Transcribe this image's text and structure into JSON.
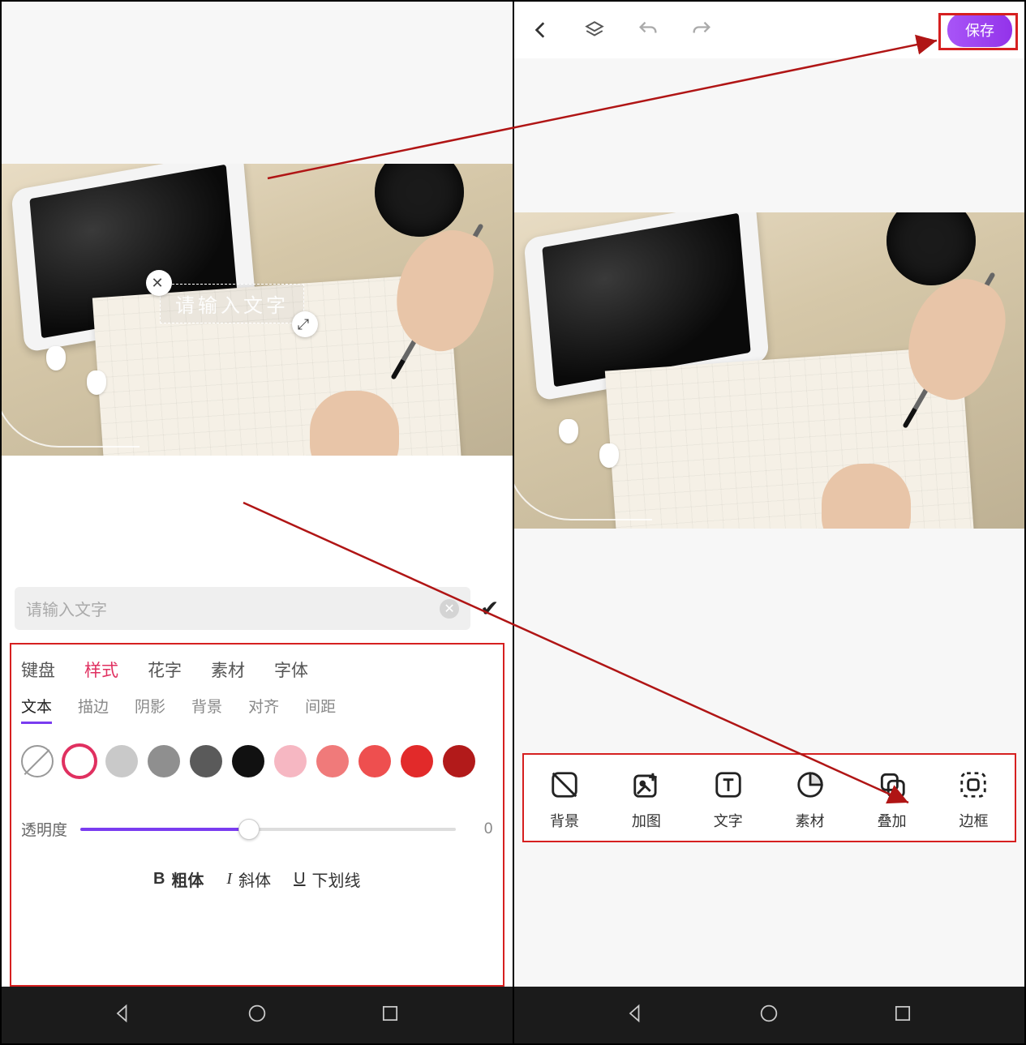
{
  "left": {
    "text_overlay_placeholder": "请输入文字",
    "input_placeholder": "请输入文字",
    "tabs": [
      "键盘",
      "样式",
      "花字",
      "素材",
      "字体"
    ],
    "active_tab": "样式",
    "subtabs": [
      "文本",
      "描边",
      "阴影",
      "背景",
      "对齐",
      "间距"
    ],
    "active_subtab": "文本",
    "swatches": [
      "none",
      "#ffffff",
      "#c9c9c9",
      "#8f8f8f",
      "#5a5a5a",
      "#111111",
      "#f6b7c2",
      "#f07a7a",
      "#ee4f4f",
      "#e22a2a",
      "#b21a1a"
    ],
    "selected_swatch_index": 1,
    "opacity_label": "透明度",
    "opacity_value": "0",
    "format": {
      "bold_symbol": "B",
      "bold_label": "粗体",
      "italic_symbol": "I",
      "italic_label": "斜体",
      "underline_symbol": "U",
      "underline_label": "下划线"
    }
  },
  "right": {
    "save_label": "保存",
    "tools": [
      {
        "key": "bg",
        "label": "背景"
      },
      {
        "key": "addimg",
        "label": "加图"
      },
      {
        "key": "text",
        "label": "文字"
      },
      {
        "key": "sticker",
        "label": "素材"
      },
      {
        "key": "overlay",
        "label": "叠加"
      },
      {
        "key": "border",
        "label": "边框"
      }
    ]
  }
}
